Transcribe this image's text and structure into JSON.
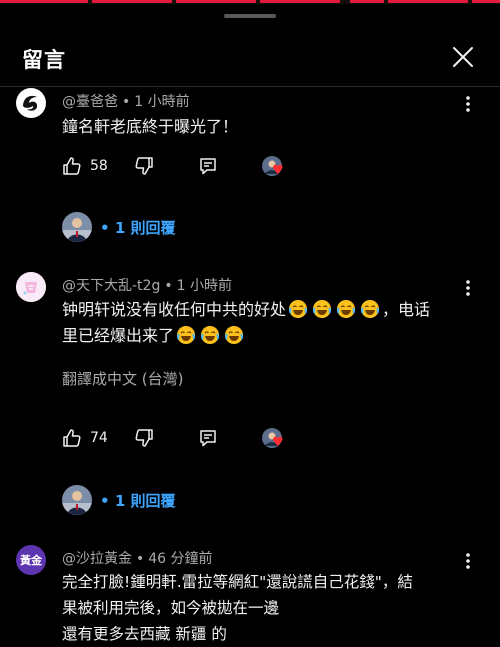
{
  "header": {
    "title": "留言"
  },
  "comments": [
    {
      "author": "@臺爸爸",
      "time": "1 小時前",
      "text": "鐘名軒老底終于曝光了！",
      "likes": "58",
      "replies_label": "1 則回覆"
    },
    {
      "author": "@天下大乱-t2g",
      "time": "1 小時前",
      "text_line1": "钟明轩说没有收任何中共的好处",
      "text_line1_end": "，电话",
      "text_line2": "里已经爆出来了",
      "translate_label": "翻譯成中文 (台灣)",
      "likes": "74",
      "replies_label": "1 則回覆"
    },
    {
      "author": "@沙拉黃金",
      "time": "46 分鐘前",
      "avatar_text": "黃金",
      "line1": "完全打臉!鍾明軒.雷拉等網紅\"還說謊自己花錢\"，結",
      "line2": "果被利用完後，如今被拋在一邊",
      "line3": "還有更多去西藏 新疆  的"
    }
  ],
  "icons": {
    "like": "thumb-up-icon",
    "dislike": "thumb-down-icon",
    "reply": "comment-icon",
    "more": "more-vert-icon",
    "close": "close-icon",
    "emoji": "face-with-tears-of-joy"
  },
  "colors": {
    "accent": "#3ea6ff",
    "heart": "#ff2d2d",
    "topbar": "#e21b3c"
  }
}
